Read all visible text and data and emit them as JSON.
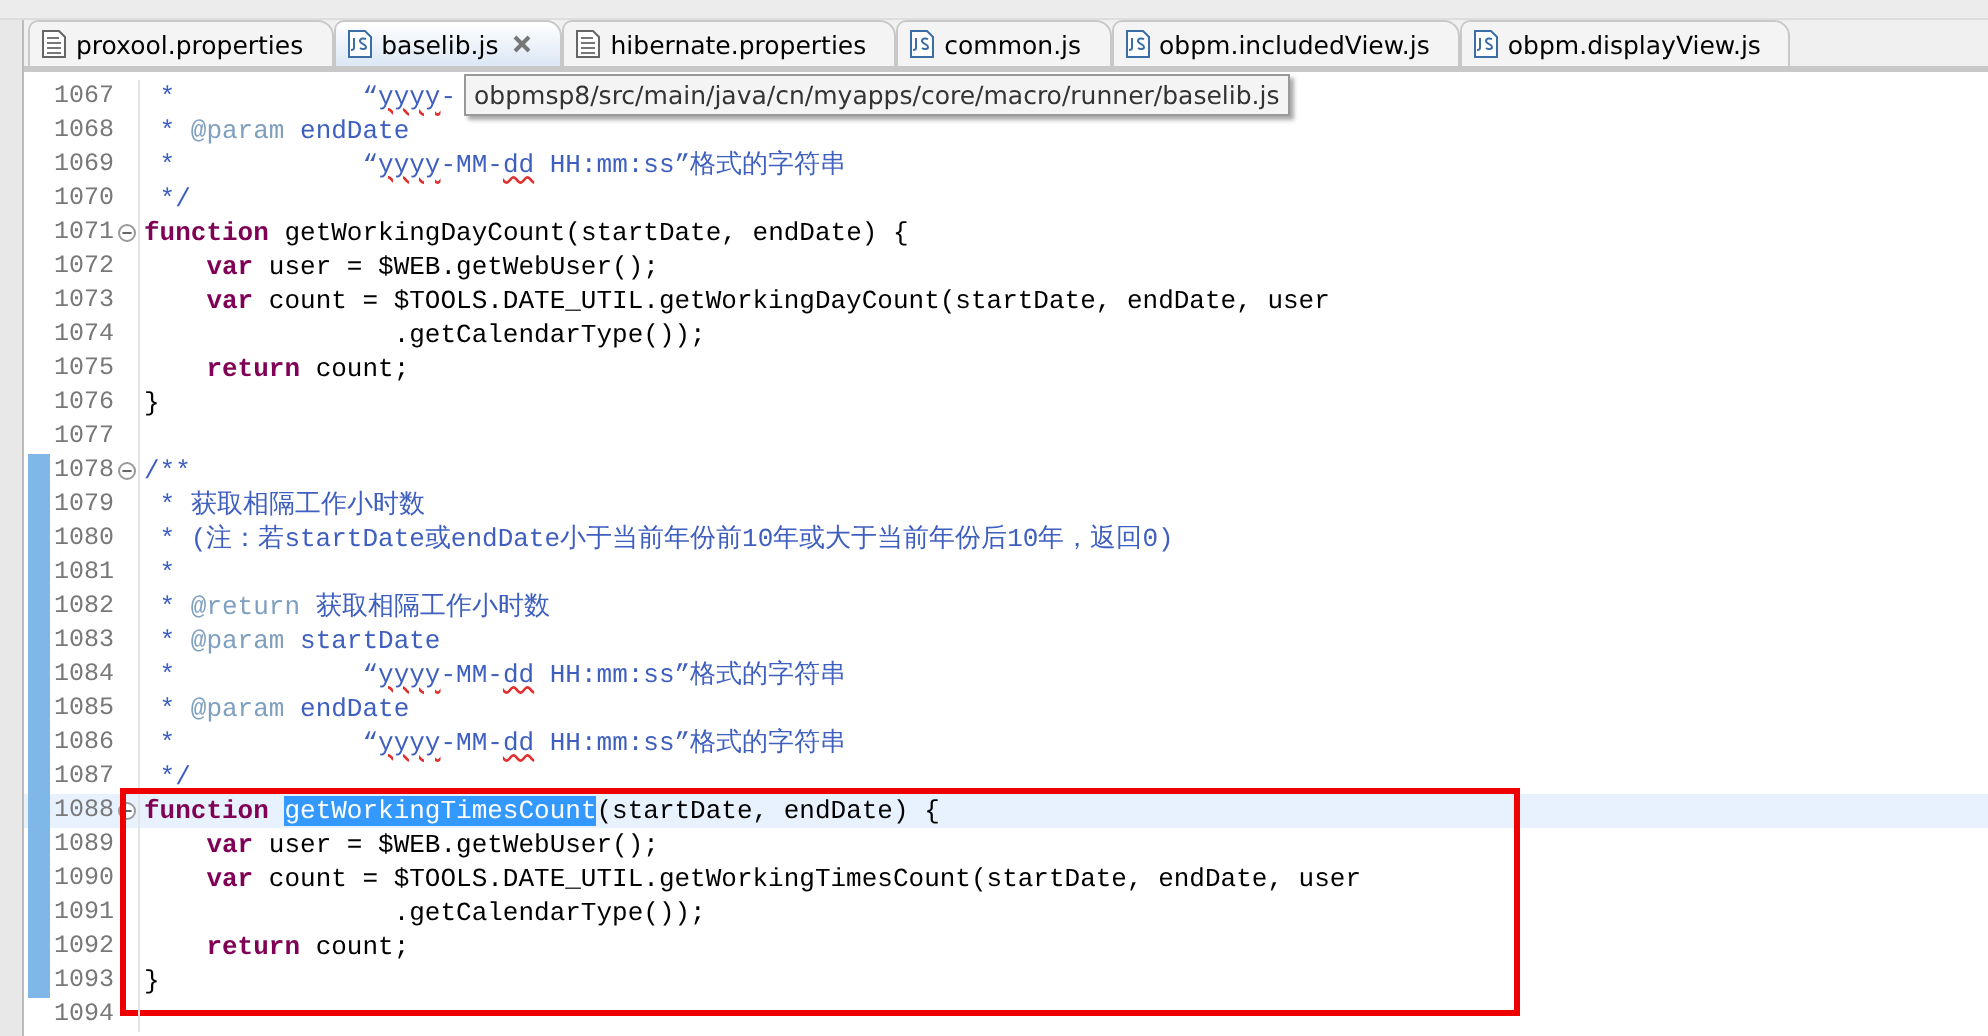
{
  "tabs": [
    {
      "label": "proxool.properties",
      "kind": "properties",
      "selected": false
    },
    {
      "label": "baselib.js",
      "kind": "js",
      "selected": true
    },
    {
      "label": "hibernate.properties",
      "kind": "properties",
      "selected": false
    },
    {
      "label": "common.js",
      "kind": "js",
      "selected": false
    },
    {
      "label": "obpm.includedView.js",
      "kind": "js",
      "selected": false
    },
    {
      "label": "obpm.displayView.js",
      "kind": "js",
      "selected": false
    }
  ],
  "tooltip": "obpmsp8/src/main/java/cn/myapps/core/macro/runner/baselib.js",
  "editor": {
    "blocks": [
      {
        "framed": false,
        "lines": [
          {
            "number": "1067",
            "changed": false,
            "fold": false,
            "current": false,
            "segments": [
              {
                "kind": "comment",
                "text": " *            “"
              },
              {
                "kind": "misspelled",
                "text": "yyyy"
              },
              {
                "kind": "comment",
                "text": "-"
              }
            ]
          },
          {
            "number": "1068",
            "changed": false,
            "fold": false,
            "current": false,
            "segments": [
              {
                "kind": "comment",
                "text": " * "
              },
              {
                "kind": "doctag",
                "text": "@param"
              },
              {
                "kind": "comment",
                "text": " endDate"
              }
            ]
          },
          {
            "number": "1069",
            "changed": false,
            "fold": false,
            "current": false,
            "segments": [
              {
                "kind": "comment",
                "text": " *            “"
              },
              {
                "kind": "misspelled",
                "text": "yyyy"
              },
              {
                "kind": "comment",
                "text": "-MM-"
              },
              {
                "kind": "misspelled",
                "text": "dd"
              },
              {
                "kind": "comment",
                "text": " HH:mm:ss”格式的字符串"
              }
            ]
          },
          {
            "number": "1070",
            "changed": false,
            "fold": false,
            "current": false,
            "segments": [
              {
                "kind": "comment",
                "text": " */"
              }
            ]
          },
          {
            "number": "1071",
            "changed": false,
            "fold": true,
            "current": false,
            "segments": [
              {
                "kind": "keyword",
                "text": "function"
              },
              {
                "kind": "plain",
                "text": " getWorkingDayCount(startDate, endDate) {"
              }
            ]
          },
          {
            "number": "1072",
            "changed": false,
            "fold": false,
            "current": false,
            "segments": [
              {
                "kind": "keyword",
                "text": "    var"
              },
              {
                "kind": "plain",
                "text": " user = $WEB.getWebUser();"
              }
            ]
          },
          {
            "number": "1073",
            "changed": false,
            "fold": false,
            "current": false,
            "segments": [
              {
                "kind": "keyword",
                "text": "    var"
              },
              {
                "kind": "plain",
                "text": " count = $TOOLS.DATE_UTIL.getWorkingDayCount(startDate, endDate, user"
              }
            ]
          },
          {
            "number": "1074",
            "changed": false,
            "fold": false,
            "current": false,
            "segments": [
              {
                "kind": "plain",
                "text": "                .getCalendarType());"
              }
            ]
          },
          {
            "number": "1075",
            "changed": false,
            "fold": false,
            "current": false,
            "segments": [
              {
                "kind": "keyword",
                "text": "    return"
              },
              {
                "kind": "plain",
                "text": " count;"
              }
            ]
          },
          {
            "number": "1076",
            "changed": false,
            "fold": false,
            "current": false,
            "segments": [
              {
                "kind": "plain",
                "text": "}"
              }
            ]
          },
          {
            "number": "1077",
            "changed": false,
            "fold": false,
            "current": false
          },
          {
            "number": "1078",
            "changed": true,
            "fold": true,
            "current": false,
            "segments": [
              {
                "kind": "comment",
                "text": "/**"
              }
            ]
          },
          {
            "number": "1079",
            "changed": true,
            "fold": false,
            "current": false,
            "segments": [
              {
                "kind": "comment",
                "text": " * 获取相隔工作小时数"
              }
            ]
          },
          {
            "number": "1080",
            "changed": true,
            "fold": false,
            "current": false,
            "segments": [
              {
                "kind": "comment",
                "text": " * (注：若startDate或endDate小于当前年份前10年或大于当前年份后10年，返回0)"
              }
            ]
          },
          {
            "number": "1081",
            "changed": true,
            "fold": false,
            "current": false,
            "segments": [
              {
                "kind": "comment",
                "text": " *"
              }
            ]
          },
          {
            "number": "1082",
            "changed": true,
            "fold": false,
            "current": false,
            "segments": [
              {
                "kind": "comment",
                "text": " * "
              },
              {
                "kind": "doctag",
                "text": "@return"
              },
              {
                "kind": "comment",
                "text": " 获取相隔工作小时数"
              }
            ]
          },
          {
            "number": "1083",
            "changed": true,
            "fold": false,
            "current": false,
            "segments": [
              {
                "kind": "comment",
                "text": " * "
              },
              {
                "kind": "doctag",
                "text": "@param"
              },
              {
                "kind": "comment",
                "text": " startDate"
              }
            ]
          },
          {
            "number": "1084",
            "changed": true,
            "fold": false,
            "current": false,
            "segments": [
              {
                "kind": "comment",
                "text": " *            “"
              },
              {
                "kind": "misspelled",
                "text": "yyyy"
              },
              {
                "kind": "comment",
                "text": "-MM-"
              },
              {
                "kind": "misspelled",
                "text": "dd"
              },
              {
                "kind": "comment",
                "text": " HH:mm:ss”格式的字符串"
              }
            ]
          },
          {
            "number": "1085",
            "changed": true,
            "fold": false,
            "current": false,
            "segments": [
              {
                "kind": "comment",
                "text": " * "
              },
              {
                "kind": "doctag",
                "text": "@param"
              },
              {
                "kind": "comment",
                "text": " endDate"
              }
            ]
          },
          {
            "number": "1086",
            "changed": true,
            "fold": false,
            "current": false,
            "segments": [
              {
                "kind": "comment",
                "text": " *            “"
              },
              {
                "kind": "misspelled",
                "text": "yyyy"
              },
              {
                "kind": "comment",
                "text": "-MM-"
              },
              {
                "kind": "misspelled",
                "text": "dd"
              },
              {
                "kind": "comment",
                "text": " HH:mm:ss”格式的字符串"
              }
            ]
          },
          {
            "number": "1087",
            "changed": true,
            "fold": false,
            "current": false,
            "segments": [
              {
                "kind": "comment",
                "text": " */"
              }
            ]
          }
        ]
      },
      {
        "framed": true,
        "lines": [
          {
            "number": "1088",
            "changed": true,
            "fold": true,
            "current": true,
            "segments": [
              {
                "kind": "keyword",
                "text": "function "
              },
              {
                "kind": "selected",
                "text": "getWorkingTimesCount"
              },
              {
                "kind": "plain",
                "text": "(startDate, endDate) {"
              }
            ]
          },
          {
            "number": "1089",
            "changed": true,
            "fold": false,
            "current": false,
            "segments": [
              {
                "kind": "keyword",
                "text": "    var"
              },
              {
                "kind": "plain",
                "text": " user = $WEB.getWebUser();"
              }
            ]
          },
          {
            "number": "1090",
            "changed": true,
            "fold": false,
            "current": false,
            "segments": [
              {
                "kind": "keyword",
                "text": "    var"
              },
              {
                "kind": "plain",
                "text": " count = $TOOLS.DATE_UTIL.getWorkingTimesCount(startDate, endDate, user"
              }
            ]
          },
          {
            "number": "1091",
            "changed": true,
            "fold": false,
            "current": false,
            "segments": [
              {
                "kind": "plain",
                "text": "                .getCalendarType());"
              }
            ]
          },
          {
            "number": "1092",
            "changed": true,
            "fold": false,
            "current": false,
            "segments": [
              {
                "kind": "keyword",
                "text": "    return"
              },
              {
                "kind": "plain",
                "text": " count;"
              }
            ]
          },
          {
            "number": "1093",
            "changed": true,
            "fold": false,
            "current": false,
            "segments": [
              {
                "kind": "plain",
                "text": "}"
              }
            ]
          }
        ]
      },
      {
        "framed": false,
        "lines": [
          {
            "number": "1094",
            "changed": false,
            "fold": false,
            "current": false
          }
        ]
      }
    ]
  }
}
